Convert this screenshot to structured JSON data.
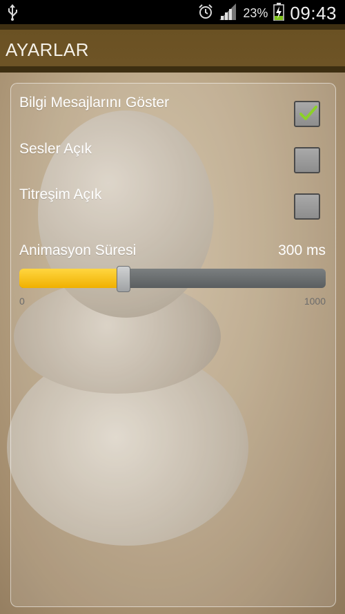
{
  "status_bar": {
    "usb_icon": "usb-icon",
    "alarm_icon": "alarm-icon",
    "signal_icon": "signal-bars-icon",
    "battery_percent": "23%",
    "battery_icon": "battery-charging-icon",
    "time": "09:43"
  },
  "action_bar": {
    "title": "AYARLAR"
  },
  "settings": {
    "items": [
      {
        "label": "Bilgi Mesajlarını Göster",
        "checked": true
      },
      {
        "label": "Sesler Açık",
        "checked": false
      },
      {
        "label": "Titreşim Açık",
        "checked": false
      }
    ],
    "slider": {
      "label": "Animasyon Süresi",
      "value_text": "300 ms",
      "value": 300,
      "min": 0,
      "max": 1000,
      "min_label": "0",
      "max_label": "1000"
    }
  },
  "colors": {
    "action_bar": "#6e5426",
    "slider_fill": "#f5c000",
    "checkmark": "#8bd129"
  }
}
